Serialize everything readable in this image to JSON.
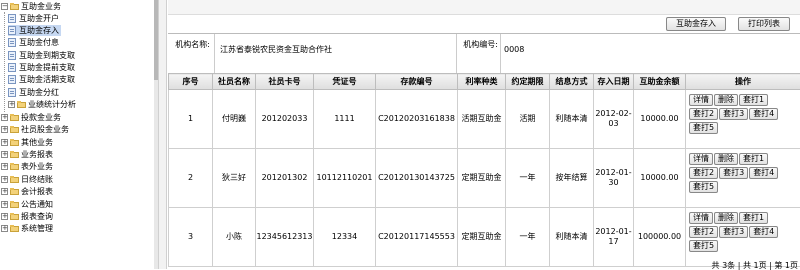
{
  "sidebar": {
    "root_label": "互助金业务",
    "children": [
      {
        "label": "互助金开户"
      },
      {
        "label": "互助金存入"
      },
      {
        "label": "互助金付息"
      },
      {
        "label": "互助金到期支取"
      },
      {
        "label": "互助金提前支取"
      },
      {
        "label": "互助金活期支取"
      },
      {
        "label": "互助金分红"
      },
      {
        "label": "业绩统计分析"
      }
    ],
    "groups": [
      {
        "label": "投款金业务"
      },
      {
        "label": "社员股金业务"
      },
      {
        "label": "其他业务"
      },
      {
        "label": "业务报表"
      },
      {
        "label": "表外业务"
      },
      {
        "label": "日终结账"
      },
      {
        "label": "会计报表"
      },
      {
        "label": "公告通知"
      },
      {
        "label": "报表查询"
      },
      {
        "label": "系统管理"
      }
    ]
  },
  "toolbar": {
    "deposit_label": "互助金存入",
    "print_label": "打印列表"
  },
  "info": {
    "org_name_label": "机构名称:",
    "org_name_value": "江苏省泰锐农民资金互助合作社",
    "org_code_label": "机构编号:",
    "org_code_value": "0008"
  },
  "table": {
    "headers": [
      "序号",
      "社员名称",
      "社员卡号",
      "凭证号",
      "存款编号",
      "利率种类",
      "约定期限",
      "结息方式",
      "存入日期",
      "互助金余额",
      "操作"
    ],
    "rows": [
      {
        "index": "1",
        "member": "付明巍",
        "card": "201202033",
        "voucher": "1111",
        "deposit_no": "C20120203161838",
        "rate_type": "活期互助金",
        "term": "活期",
        "interest": "利随本清",
        "date": "2012-02-03",
        "balance": "10000.00"
      },
      {
        "index": "2",
        "member": "狄三好",
        "card": "201201302",
        "voucher": "10112110201",
        "deposit_no": "C20120130143725",
        "rate_type": "定期互助金",
        "term": "一年",
        "interest": "按年结算",
        "date": "2012-01-30",
        "balance": "10000.00"
      },
      {
        "index": "3",
        "member": "小陈",
        "card": "12345612313",
        "voucher": "12334",
        "deposit_no": "C20120117145553",
        "rate_type": "定期互助金",
        "term": "一年",
        "interest": "利随本清",
        "date": "2012-01-17",
        "balance": "100000.00"
      }
    ],
    "actions": {
      "detail": "详情",
      "delete": "删除",
      "print1": "套打1",
      "print2": "套打2",
      "print3": "套打3",
      "print4": "套打4",
      "print5": "套打5"
    }
  },
  "pager": {
    "text": "共 3条 | 共 1页 | 第 1页"
  }
}
